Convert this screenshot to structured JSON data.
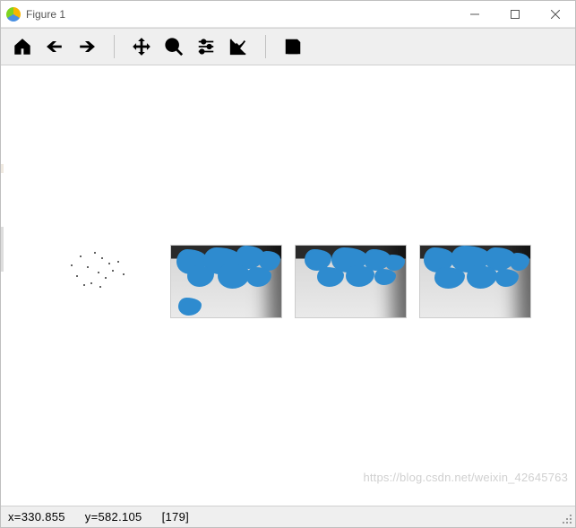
{
  "window": {
    "title": "Figure 1"
  },
  "toolbar": {
    "home": "Home",
    "back": "Back",
    "forward": "Forward",
    "pan": "Pan",
    "zoom": "Zoom",
    "configure": "Configure subplots",
    "edit": "Edit axis, curve and image parameters",
    "save": "Save the figure"
  },
  "status": {
    "x_label": "x=",
    "x_value": "330.855",
    "y_label": "y=",
    "y_value": "582.105",
    "pixel_value": "[179]"
  },
  "watermark": "https://blog.csdn.net/weixin_42645763",
  "chart_data": {
    "type": "table",
    "description": "Four subplots in a single row inside a Matplotlib Figure window. Subplot 1: a sparse scatter of small dark feature points on a white image. Subplots 2–4: the same grayscale room photo overlaid with blue blob SIFT/SURF-like keypoint clusters of varying density.",
    "subplots": [
      {
        "index": 1,
        "kind": "sparse-feature-points",
        "background": "white",
        "overlay": "tiny black dots"
      },
      {
        "index": 2,
        "kind": "photo-with-blobs",
        "background": "grayscale room",
        "overlay": "blue blobs (dense)"
      },
      {
        "index": 3,
        "kind": "photo-with-blobs",
        "background": "grayscale room",
        "overlay": "blue blobs (medium)"
      },
      {
        "index": 4,
        "kind": "photo-with-blobs",
        "background": "grayscale room",
        "overlay": "blue blobs (dense)"
      }
    ],
    "cursor": {
      "x": 330.855,
      "y": 582.105,
      "intensity": 179
    }
  }
}
